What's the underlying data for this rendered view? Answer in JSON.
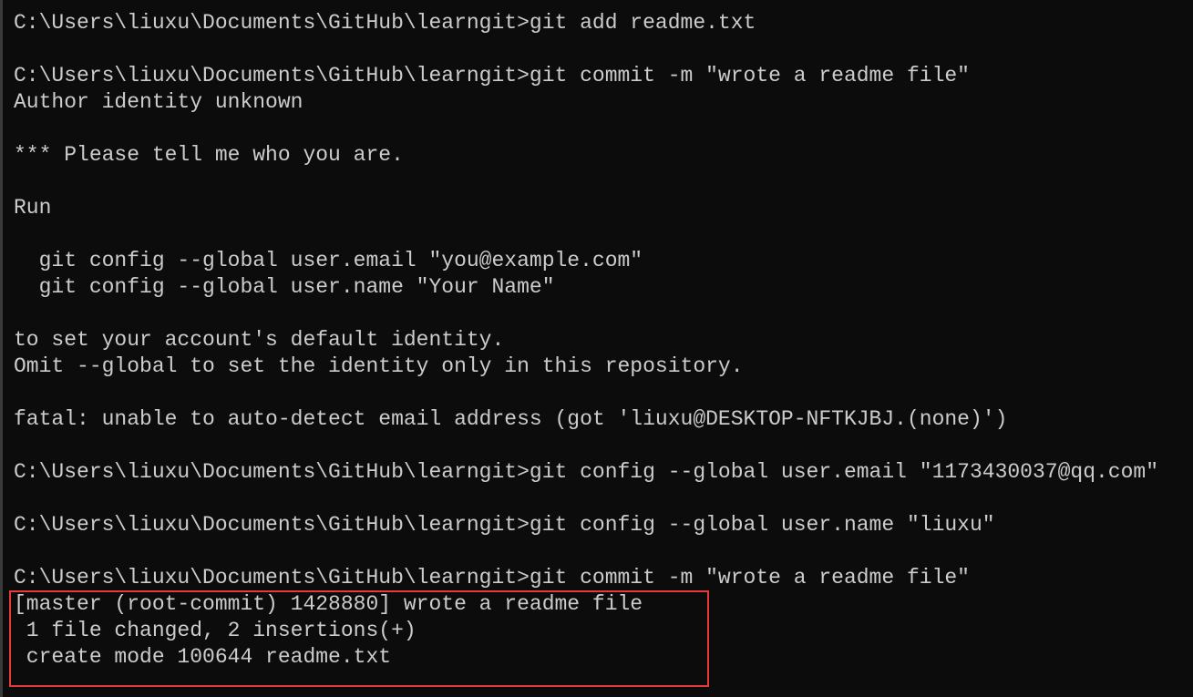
{
  "terminal": {
    "background": "#0c0c0c",
    "foreground": "#cccccc",
    "lines": [
      "C:\\Users\\liuxu\\Documents\\GitHub\\learngit>git add readme.txt",
      "",
      "C:\\Users\\liuxu\\Documents\\GitHub\\learngit>git commit -m \"wrote a readme file\"",
      "Author identity unknown",
      "",
      "*** Please tell me who you are.",
      "",
      "Run",
      "",
      "  git config --global user.email \"you@example.com\"",
      "  git config --global user.name \"Your Name\"",
      "",
      "to set your account's default identity.",
      "Omit --global to set the identity only in this repository.",
      "",
      "fatal: unable to auto-detect email address (got 'liuxu@DESKTOP-NFTKJBJ.(none)')",
      "",
      "C:\\Users\\liuxu\\Documents\\GitHub\\learngit>git config --global user.email \"1173430037@qq.com\"",
      "",
      "C:\\Users\\liuxu\\Documents\\GitHub\\learngit>git config --global user.name \"liuxu\"",
      "",
      "C:\\Users\\liuxu\\Documents\\GitHub\\learngit>git commit -m \"wrote a readme file\"",
      "[master (root-commit) 1428880] wrote a readme file",
      " 1 file changed, 2 insertions(+)",
      " create mode 100644 readme.txt"
    ]
  },
  "highlight": {
    "color": "#e8393b"
  }
}
